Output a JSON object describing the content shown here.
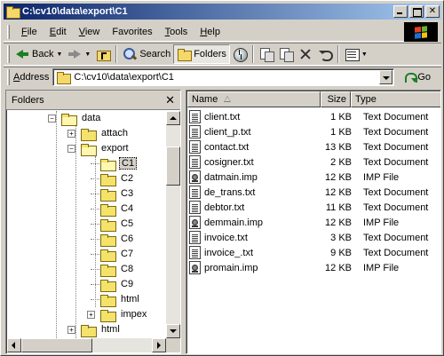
{
  "window": {
    "title": "C:\\cv10\\data\\export\\C1"
  },
  "menu": [
    {
      "label": "File",
      "u": "F",
      "rest": "ile"
    },
    {
      "label": "Edit",
      "u": "E",
      "rest": "dit"
    },
    {
      "label": "View",
      "u": "V",
      "rest": "iew"
    },
    {
      "label": "Favorites",
      "u": "",
      "rest": "Favorites"
    },
    {
      "label": "Tools",
      "u": "T",
      "rest": "ools"
    },
    {
      "label": "Help",
      "u": "H",
      "rest": "elp"
    }
  ],
  "toolbar": {
    "back_label": "Back",
    "search_label": "Search",
    "folders_label": "Folders"
  },
  "address": {
    "label_u": "A",
    "label_rest": "ddress",
    "value": "C:\\cv10\\data\\export\\C1",
    "go_label": "Go"
  },
  "folders_pane": {
    "title": "Folders",
    "close_glyph": "✕",
    "items": [
      {
        "label": "data",
        "level": 0,
        "expander": "minus",
        "open": true
      },
      {
        "label": "attach",
        "level": 1,
        "expander": "plus"
      },
      {
        "label": "export",
        "level": 1,
        "expander": "minus",
        "open": true
      },
      {
        "label": "C1",
        "level": 2,
        "expander": "",
        "open": true,
        "selected": true
      },
      {
        "label": "C2",
        "level": 2,
        "expander": ""
      },
      {
        "label": "C3",
        "level": 2,
        "expander": ""
      },
      {
        "label": "C4",
        "level": 2,
        "expander": ""
      },
      {
        "label": "C5",
        "level": 2,
        "expander": ""
      },
      {
        "label": "C6",
        "level": 2,
        "expander": ""
      },
      {
        "label": "C7",
        "level": 2,
        "expander": ""
      },
      {
        "label": "C8",
        "level": 2,
        "expander": ""
      },
      {
        "label": "C9",
        "level": 2,
        "expander": ""
      },
      {
        "label": "html",
        "level": 2,
        "expander": ""
      },
      {
        "label": "impex",
        "level": 2,
        "expander": "plus"
      },
      {
        "label": "html",
        "level": 1,
        "expander": "plus"
      }
    ]
  },
  "file_list": {
    "columns": {
      "name": "Name",
      "size": "Size",
      "type": "Type"
    },
    "rows": [
      {
        "name": "client.txt",
        "size": "1 KB",
        "type": "Text Document",
        "icon": "text-file-icon"
      },
      {
        "name": "client_p.txt",
        "size": "1 KB",
        "type": "Text Document",
        "icon": "text-file-icon"
      },
      {
        "name": "contact.txt",
        "size": "13 KB",
        "type": "Text Document",
        "icon": "text-file-icon"
      },
      {
        "name": "cosigner.txt",
        "size": "2 KB",
        "type": "Text Document",
        "icon": "text-file-icon"
      },
      {
        "name": "datmain.imp",
        "size": "12 KB",
        "type": "IMP File",
        "icon": "imp-file-icon"
      },
      {
        "name": "de_trans.txt",
        "size": "12 KB",
        "type": "Text Document",
        "icon": "text-file-icon"
      },
      {
        "name": "debtor.txt",
        "size": "11 KB",
        "type": "Text Document",
        "icon": "text-file-icon"
      },
      {
        "name": "demmain.imp",
        "size": "12 KB",
        "type": "IMP File",
        "icon": "imp-file-icon"
      },
      {
        "name": "invoice.txt",
        "size": "3 KB",
        "type": "Text Document",
        "icon": "text-file-icon"
      },
      {
        "name": "invoice_.txt",
        "size": "9 KB",
        "type": "Text Document",
        "icon": "text-file-icon"
      },
      {
        "name": "promain.imp",
        "size": "12 KB",
        "type": "IMP File",
        "icon": "imp-file-icon"
      }
    ]
  },
  "colors": {
    "title_start": "#0a246a",
    "title_end": "#a6caf0",
    "chrome": "#d4d0c8",
    "folder": "#f4e26a"
  }
}
